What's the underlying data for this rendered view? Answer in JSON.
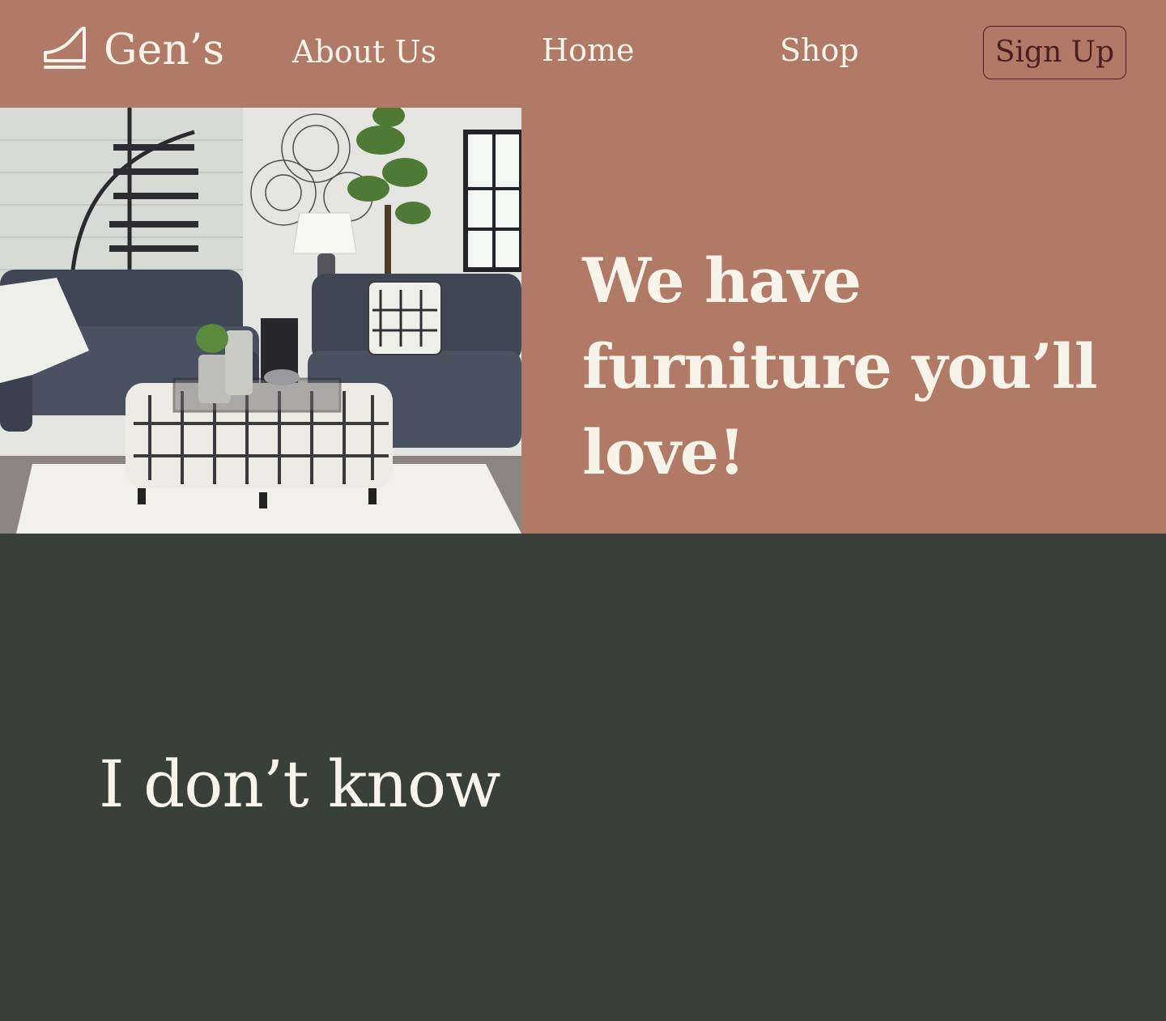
{
  "header": {
    "brand_name": "Gen’s",
    "logo_icon": "chair-icon",
    "nav_links": [
      {
        "label": "About Us"
      },
      {
        "label": "Home"
      },
      {
        "label": "Shop"
      }
    ],
    "signup_label": "Sign Up"
  },
  "hero": {
    "image_description": "living-room-photo",
    "title": "We have furniture you’ll love!"
  },
  "section": {
    "heading": "I don’t know"
  },
  "colors": {
    "header_background": "#b17a66",
    "section_background": "#394039",
    "text_light": "#f8f4ea",
    "signup_text": "#4b1f22"
  }
}
